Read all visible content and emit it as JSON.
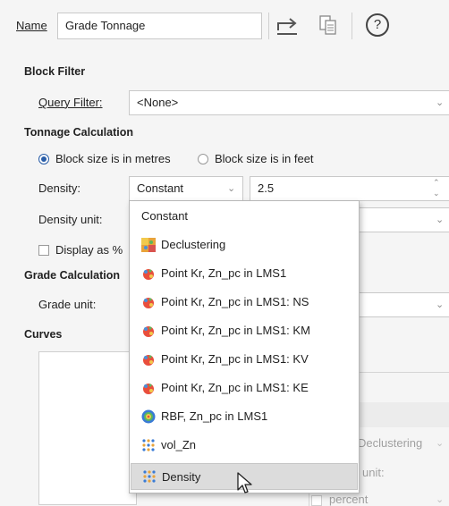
{
  "header": {
    "name_label": "Name",
    "name_value": "Grade Tonnage",
    "help_symbol": "?"
  },
  "block_filter": {
    "title": "Block Filter",
    "query_label": "Query Filter:",
    "query_value": "<None>"
  },
  "tonnage": {
    "title": "Tonnage Calculation",
    "radio_metres": "Block size is in metres",
    "radio_feet": "Block size is in feet",
    "density_label": "Density:",
    "density_mode": "Constant",
    "density_value": "2.5",
    "density_unit_label": "Density unit:",
    "display_as_label": "Display as %"
  },
  "grade": {
    "title": "Grade Calculation",
    "grade_unit_label": "Grade unit:"
  },
  "curves": {
    "title": "Curves",
    "behind_declustering": "Declustering",
    "behind_unit": "unit:",
    "behind_percent": "percent"
  },
  "dropdown": {
    "items": [
      {
        "label": "Constant",
        "icon": "none"
      },
      {
        "label": "Declustering",
        "icon": "declustering-icon"
      },
      {
        "label": "Point Kr, Zn_pc in LMS1",
        "icon": "kriging-icon"
      },
      {
        "label": "Point Kr, Zn_pc in LMS1: NS",
        "icon": "kriging-icon"
      },
      {
        "label": "Point Kr, Zn_pc in LMS1: KM",
        "icon": "kriging-icon"
      },
      {
        "label": "Point Kr, Zn_pc in LMS1: KV",
        "icon": "kriging-icon"
      },
      {
        "label": "Point Kr, Zn_pc in LMS1: KE",
        "icon": "kriging-icon"
      },
      {
        "label": "RBF, Zn_pc in LMS1",
        "icon": "rbf-icon"
      },
      {
        "label": "vol_Zn",
        "icon": "points-icon"
      },
      {
        "label": "Density",
        "icon": "points-icon"
      }
    ]
  },
  "colors": {
    "accent": "#2a5ea8",
    "selected_row": "#dcdcdc",
    "background": "#f5f5f5"
  }
}
